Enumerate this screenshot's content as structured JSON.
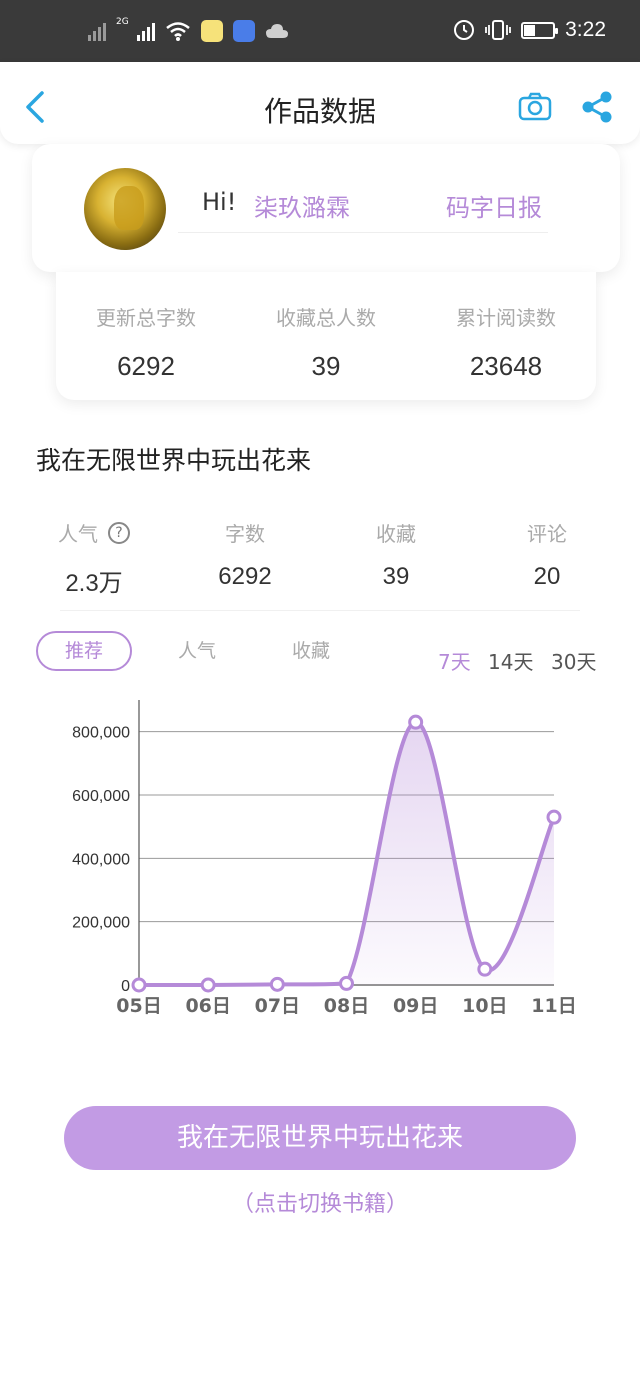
{
  "status_bar": {
    "network_type": "2G",
    "time": "3:22",
    "battery_level": 0.4
  },
  "header": {
    "title": "作品数据"
  },
  "profile": {
    "greeting": "Hi!",
    "username": "柒玖潞霖",
    "daily_report_label": "码字日报"
  },
  "totals": [
    {
      "label": "更新总字数",
      "value": "6292"
    },
    {
      "label": "收藏总人数",
      "value": "39"
    },
    {
      "label": "累计阅读数",
      "value": "23648"
    }
  ],
  "book": {
    "title": "我在无限世界中玩出花来",
    "metrics": [
      {
        "label": "人气",
        "value": "2.3万"
      },
      {
        "label": "字数",
        "value": "6292"
      },
      {
        "label": "收藏",
        "value": "39"
      },
      {
        "label": "评论",
        "value": "20"
      }
    ]
  },
  "tabs": [
    {
      "label": "推荐",
      "active": true
    },
    {
      "label": "人气",
      "active": false
    },
    {
      "label": "收藏",
      "active": false
    }
  ],
  "ranges": [
    {
      "label": "7天",
      "active": true
    },
    {
      "label": "14天",
      "active": false
    },
    {
      "label": "30天",
      "active": false
    }
  ],
  "chart_data": {
    "type": "area",
    "categories": [
      "05日",
      "06日",
      "07日",
      "08日",
      "09日",
      "10日",
      "11日"
    ],
    "values": [
      0,
      0,
      2000,
      5000,
      830000,
      50000,
      530000
    ],
    "y_ticks": [
      0,
      200000,
      400000,
      600000,
      800000
    ],
    "y_tick_labels": [
      "0",
      "200,000",
      "400,000",
      "600,000",
      "800,000"
    ],
    "ylim": [
      0,
      900000
    ],
    "grid": true,
    "color": "#b58ad8"
  },
  "book_button": {
    "label": "我在无限世界中玩出花来",
    "hint": "（点击切换书籍）"
  },
  "colors": {
    "accent": "#b58ad8",
    "button": "#c29be4",
    "nav_icon": "#2aa6e0",
    "statusbar": "#3a3a3a"
  }
}
